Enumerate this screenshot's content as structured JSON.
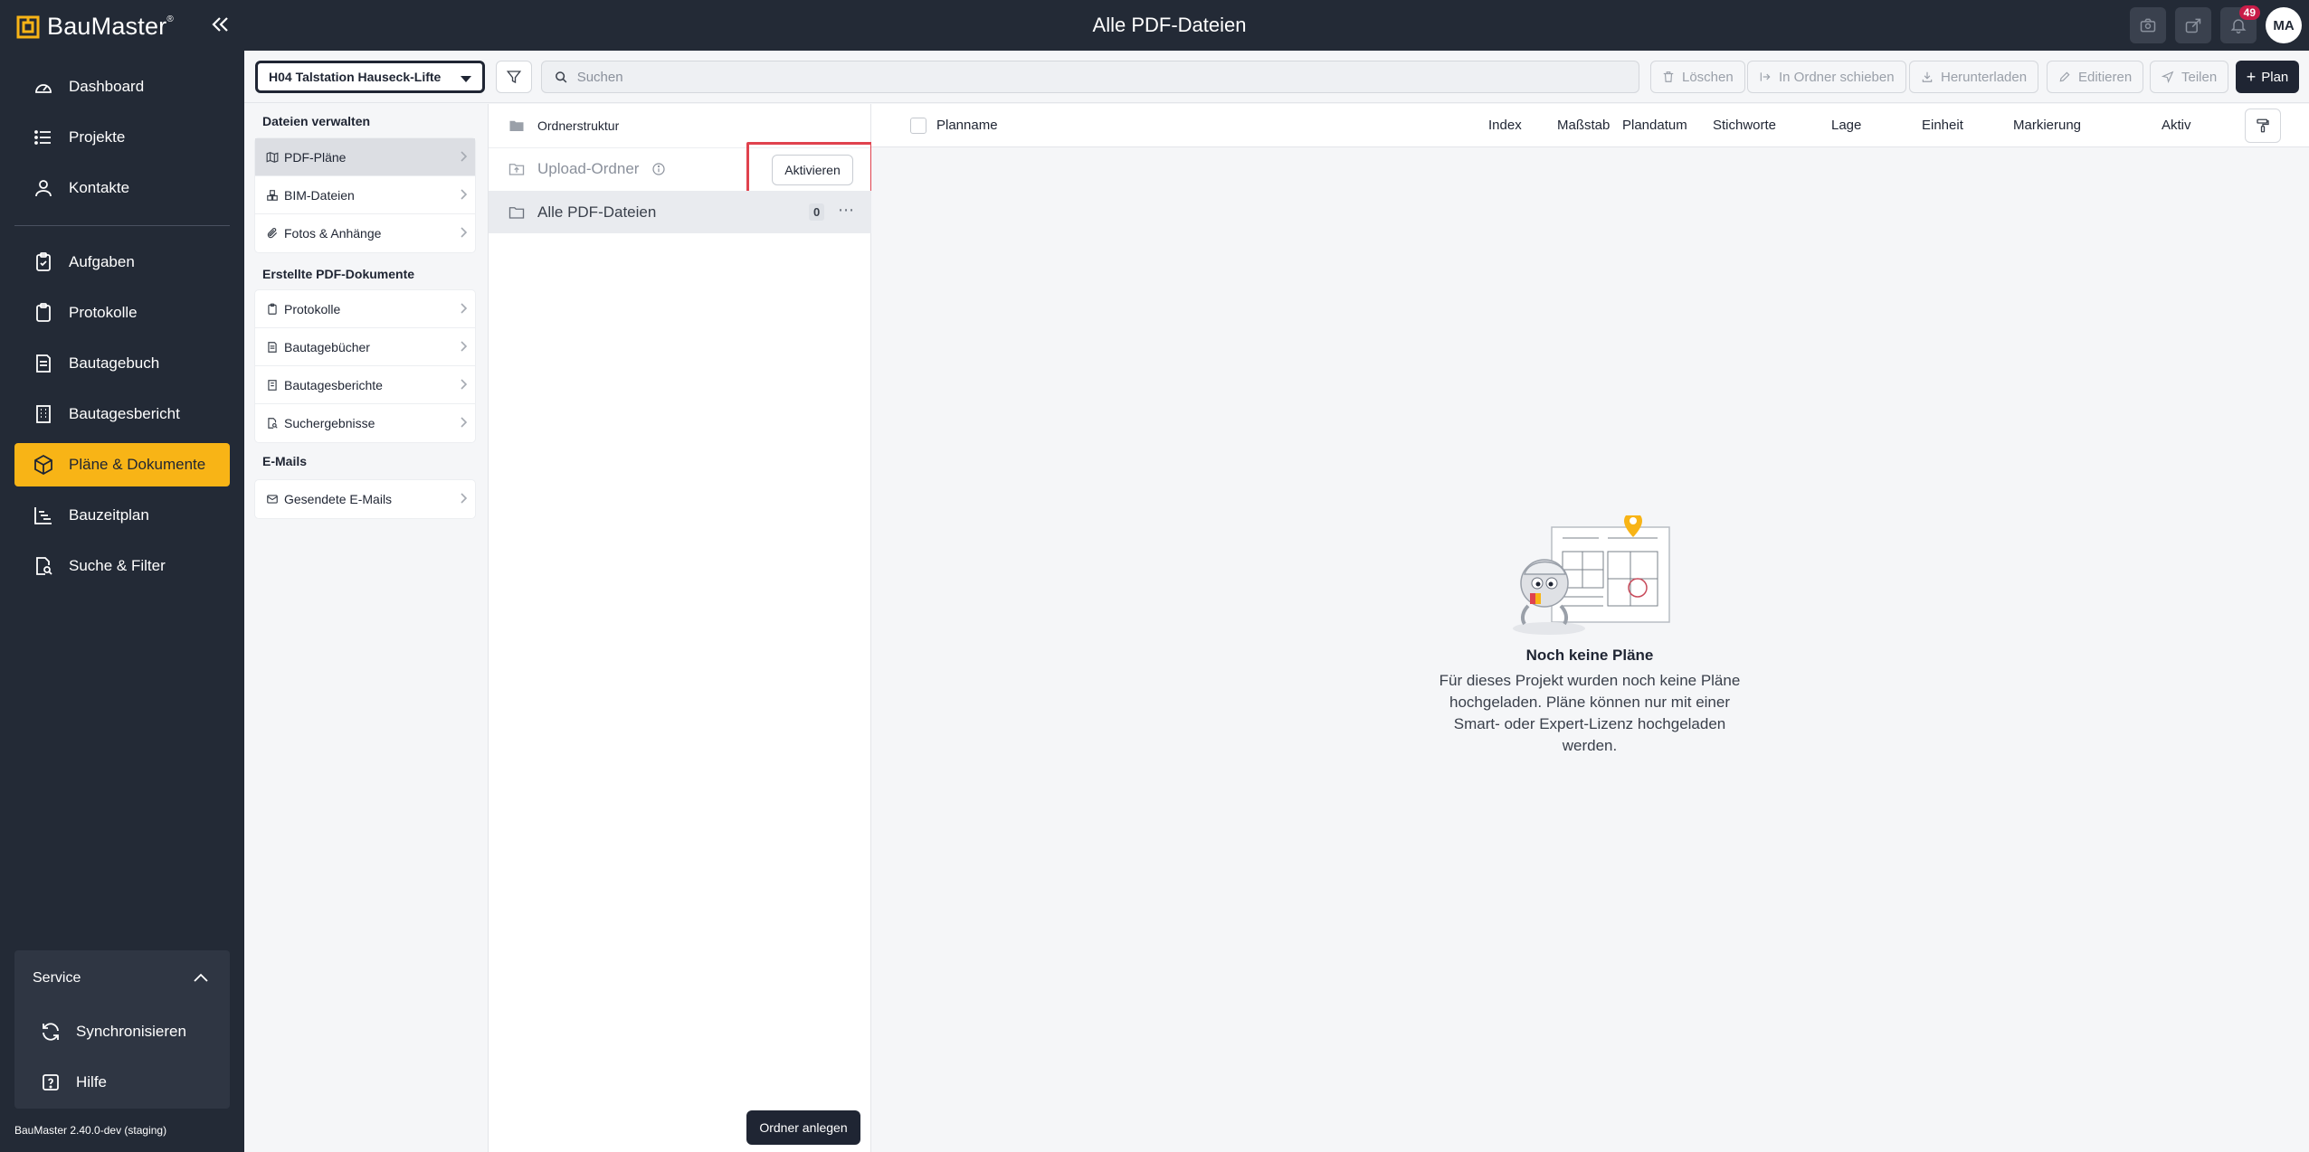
{
  "app": {
    "logo_text": "BauMaster",
    "page_title": "Alle PDF-Dateien",
    "version": "BauMaster 2.40.0-dev (staging)",
    "accent_color": "#f8b416",
    "dark_color": "#232a36"
  },
  "topbar": {
    "notification_count": "49",
    "avatar_initials": "MA",
    "icons": [
      "camera-icon",
      "share-icon",
      "bell-icon"
    ]
  },
  "nav": {
    "items": [
      {
        "label": "Dashboard",
        "icon": "gauge-icon"
      },
      {
        "label": "Projekte",
        "icon": "list-icon"
      },
      {
        "label": "Kontakte",
        "icon": "user-icon"
      },
      {
        "label": "Aufgaben",
        "icon": "clipboard-check-icon"
      },
      {
        "label": "Protokolle",
        "icon": "clipboard-icon"
      },
      {
        "label": "Bautagebuch",
        "icon": "book-icon"
      },
      {
        "label": "Bautagesbericht",
        "icon": "building-icon"
      },
      {
        "label": "Pläne & Dokumente",
        "icon": "cube-icon",
        "active": true
      },
      {
        "label": "Bauzeitplan",
        "icon": "chart-icon"
      },
      {
        "label": "Suche & Filter",
        "icon": "search-doc-icon"
      }
    ]
  },
  "service": {
    "title": "Service",
    "items": [
      {
        "label": "Synchronisieren",
        "icon": "sync-icon"
      },
      {
        "label": "Hilfe",
        "icon": "help-icon"
      }
    ]
  },
  "toolbar": {
    "project": "H04 Talstation Hauseck-Lifte",
    "search_placeholder": "Suchen",
    "actions": {
      "delete": "Löschen",
      "move": "In Ordner schieben",
      "download": "Herunterladen",
      "edit": "Editieren",
      "share": "Teilen",
      "add_plan": "Plan"
    }
  },
  "files_menu": {
    "manage_title": "Dateien verwalten",
    "manage_items": [
      "PDF-Pläne",
      "BIM-Dateien",
      "Fotos & Anhänge"
    ],
    "created_title": "Erstellte PDF-Dokumente",
    "created_items": [
      "Protokolle",
      "Bautagebücher",
      "Bautagesberichte",
      "Suchergebnisse"
    ],
    "email_title": "E-Mails",
    "email_items": [
      "Gesendete E-Mails"
    ]
  },
  "folders": {
    "header": "Ordnerstruktur",
    "upload_folder": "Upload-Ordner",
    "activate_button": "Aktivieren",
    "all_pdfs": "Alle PDF-Dateien",
    "all_pdfs_count": "0",
    "new_folder_button": "Ordner anlegen"
  },
  "table": {
    "columns": [
      "Planname",
      "Index",
      "Maßstab",
      "Plandatum",
      "Stichworte",
      "Lage",
      "Einheit",
      "Markierung",
      "Aktiv"
    ]
  },
  "empty_state": {
    "title": "Noch keine Pläne",
    "text": "Für dieses Projekt wurden noch keine Pläne hochgeladen. Pläne können nur mit einer Smart- oder Expert-Lizenz hochgeladen werden."
  }
}
